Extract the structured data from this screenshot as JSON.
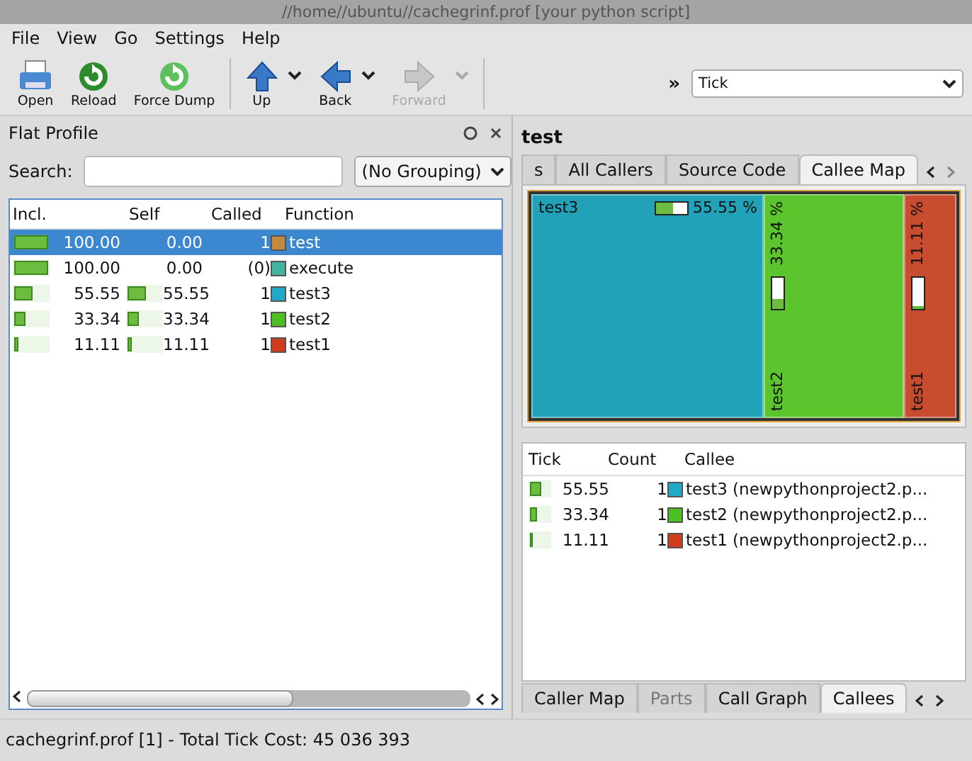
{
  "window": {
    "title": "//home//ubuntu//cachegrinf.prof [your python script]"
  },
  "menu": [
    "File",
    "View",
    "Go",
    "Settings",
    "Help"
  ],
  "toolbar": [
    {
      "label": "Open",
      "kind": "open",
      "disabled": false,
      "dropdown": false
    },
    {
      "label": "Reload",
      "kind": "reload",
      "disabled": false,
      "dropdown": false
    },
    {
      "label": "Force Dump",
      "kind": "dump",
      "disabled": false,
      "dropdown": false
    },
    {
      "label": "Up",
      "kind": "up",
      "disabled": false,
      "dropdown": true
    },
    {
      "label": "Back",
      "kind": "back",
      "disabled": false,
      "dropdown": true
    },
    {
      "label": "Forward",
      "kind": "forward",
      "disabled": true,
      "dropdown": true
    }
  ],
  "overflow": "»",
  "event_type": {
    "value": "Tick"
  },
  "flat_profile": {
    "title": "Flat Profile",
    "search_label": "Search:",
    "grouping": "(No Grouping)",
    "columns": [
      "Incl.",
      "Self",
      "Called",
      "Function"
    ],
    "rows": [
      {
        "incl": {
          "value": "100.00",
          "level": 1
        },
        "self": {
          "value": "0.00"
        },
        "called": "1",
        "function": "test",
        "color": "#c08a40",
        "selected": true
      },
      {
        "incl": {
          "value": "100.00",
          "level": 1
        },
        "self": {
          "value": "0.00"
        },
        "called": "(0)",
        "function": "execute",
        "color": "#40b4a0",
        "selected": false
      },
      {
        "incl": {
          "value": "55.55",
          "level": 0.5555
        },
        "self": {
          "value": "55.55",
          "level": 0.5555
        },
        "called": "1",
        "function": "test3",
        "color": "#22a8c8",
        "selected": false
      },
      {
        "incl": {
          "value": "33.34",
          "level": 0.3334
        },
        "self": {
          "value": "33.34",
          "level": 0.3334
        },
        "called": "1",
        "function": "test2",
        "color": "#4cc020",
        "selected": false
      },
      {
        "incl": {
          "value": "11.11",
          "level": 0.1111
        },
        "self": {
          "value": "11.11",
          "level": 0.1111
        },
        "called": "1",
        "function": "test1",
        "color": "#d03c1c",
        "selected": false
      }
    ]
  },
  "detail": {
    "title": "test",
    "tabs": [
      {
        "label": "s",
        "selected": false,
        "disabled": false
      },
      {
        "label": "All Callers",
        "selected": false,
        "disabled": false
      },
      {
        "label": "Source Code",
        "selected": false,
        "disabled": false
      },
      {
        "label": "Callee Map",
        "selected": true,
        "disabled": false
      }
    ],
    "callee_map": [
      {
        "name": "test3",
        "percent": "55.55 %",
        "level": 0.5555,
        "color": "#22a2b8",
        "kind": "wide"
      },
      {
        "name": "test2",
        "percent": "33.34 %",
        "level": 0.3334,
        "color": "#5cc42c",
        "kind": "tall"
      },
      {
        "name": "test1",
        "percent": "11.11 %",
        "level": 0.1111,
        "color": "#c84c30",
        "kind": "tall"
      }
    ],
    "callees": {
      "columns": [
        "Tick",
        "Count",
        "Callee"
      ],
      "rows": [
        {
          "tick": "55.55",
          "level": 0.5555,
          "count": "1",
          "callee": "test3 (newpythonproject2.p...",
          "color": "#22a8c8"
        },
        {
          "tick": "33.34",
          "level": 0.3334,
          "count": "1",
          "callee": "test2 (newpythonproject2.p...",
          "color": "#4cc020"
        },
        {
          "tick": "11.11",
          "level": 0.1111,
          "count": "1",
          "callee": "test1 (newpythonproject2.p...",
          "color": "#d03c1c"
        }
      ]
    },
    "bottom_tabs": [
      {
        "label": "Caller Map",
        "selected": false,
        "disabled": false
      },
      {
        "label": "Parts",
        "selected": false,
        "disabled": true
      },
      {
        "label": "Call Graph",
        "selected": false,
        "disabled": false
      },
      {
        "label": "Callees",
        "selected": true,
        "disabled": false
      }
    ]
  },
  "status_bar": "cachegrinf.prof [1] - Total Tick Cost:  45 036 393"
}
